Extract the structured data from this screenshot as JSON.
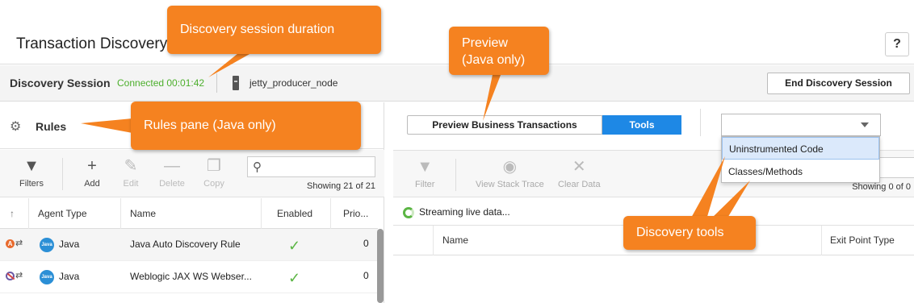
{
  "header": {
    "title": "Transaction Discovery",
    "help_label": "?"
  },
  "session": {
    "label": "Discovery Session",
    "status": "Connected 00:01:42",
    "node": "jetty_producer_node",
    "end_button": "End Discovery Session"
  },
  "rules_pane": {
    "title": "Rules",
    "toolbar": [
      {
        "label": "Filters",
        "icon": "filter-icon",
        "enabled": true
      },
      {
        "label": "Add",
        "icon": "plus-icon",
        "enabled": true
      },
      {
        "label": "Edit",
        "icon": "pencil-icon",
        "enabled": false
      },
      {
        "label": "Delete",
        "icon": "minus-icon",
        "enabled": false
      },
      {
        "label": "Copy",
        "icon": "copy-icon",
        "enabled": false
      }
    ],
    "search_placeholder": "",
    "showing": "Showing 21 of 21",
    "columns": [
      "Agent Type",
      "Name",
      "Enabled",
      "Prio..."
    ],
    "rows": [
      {
        "badge": "Java",
        "agent_type": "Java",
        "name": "Java Auto Discovery Rule",
        "enabled": "✓",
        "priority": "0"
      },
      {
        "badge": "Java",
        "agent_type": "Java",
        "name": "Weblogic JAX WS Webser...",
        "enabled": "✓",
        "priority": "0"
      }
    ]
  },
  "tools_pane": {
    "tabs": [
      "Preview Business Transactions",
      "Tools"
    ],
    "active_tab": "Tools",
    "dropdown_value": "",
    "dropdown_options": [
      "Uninstrumented Code",
      "Classes/Methods"
    ],
    "toolbar": [
      {
        "label": "Filter",
        "icon": "filter-icon"
      },
      {
        "label": "View Stack Trace",
        "icon": "eye-icon"
      },
      {
        "label": "Clear Data",
        "icon": "close-icon"
      }
    ],
    "showing": "Showing 0 of 0",
    "streaming": "Streaming live data...",
    "columns": [
      "Name",
      "Exit Point Type"
    ]
  },
  "callouts": {
    "duration": "Discovery session duration",
    "preview_line1": "Preview",
    "preview_line2": "(Java only)",
    "rules": "Rules pane (Java only)",
    "tools": "Discovery tools"
  },
  "colors": {
    "accent": "#1e88e5",
    "callout": "#f58220",
    "connected": "#4caf2c"
  }
}
